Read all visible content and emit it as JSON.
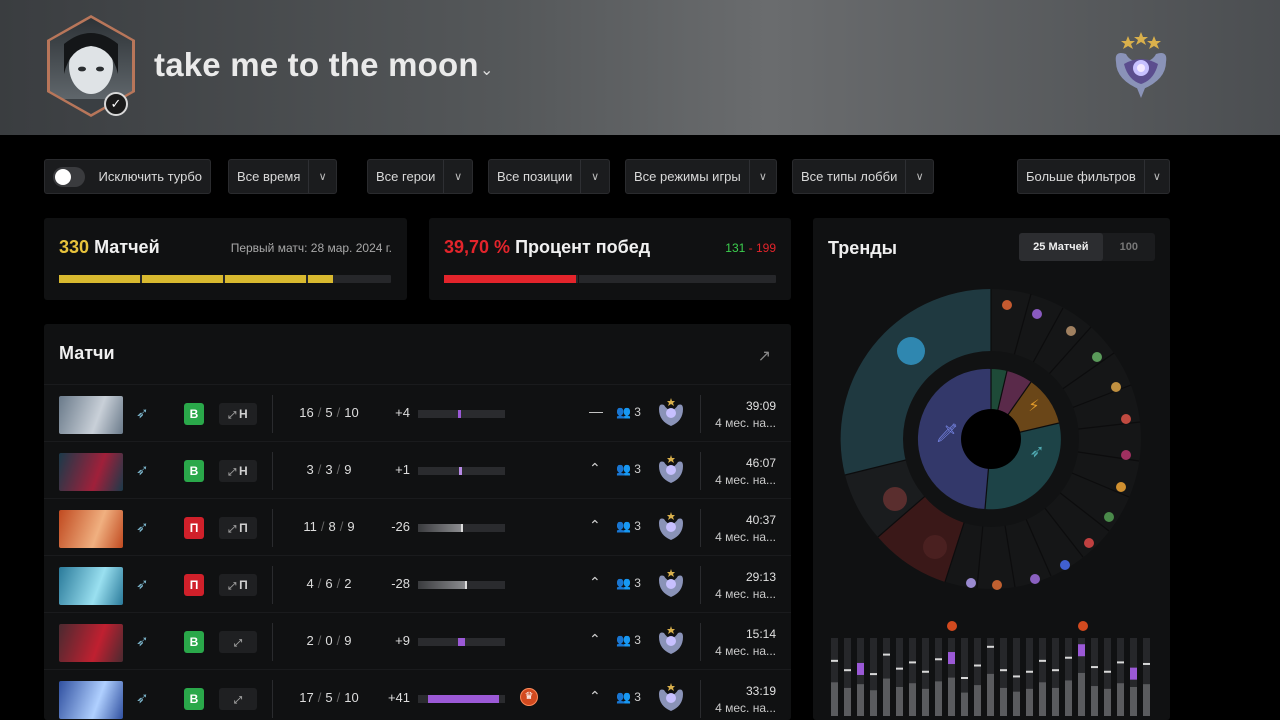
{
  "profile": {
    "name": "take me to the moon",
    "verified_mark": "✓",
    "chevron": "⌄"
  },
  "filters": [
    {
      "label": "Исключить турбо",
      "type": "toggle"
    },
    {
      "label": "Все время"
    },
    {
      "label": "Все герои"
    },
    {
      "label": "Все позиции"
    },
    {
      "label": "Все режимы игры"
    },
    {
      "label": "Все типы лобби"
    },
    {
      "label": "Больше фильтров"
    }
  ],
  "stats": {
    "matches": {
      "count": "330",
      "label": "Матчей",
      "first_match": "Первый матч: 28 мар. 2024 г."
    },
    "winrate": {
      "value": "39,70 %",
      "label": "Процент побед",
      "wins": "131",
      "dash": " - ",
      "losses": "199",
      "fraction": 0.397
    }
  },
  "matches_panel": {
    "title": "Матчи",
    "rows": [
      {
        "result": "В",
        "win": true,
        "lane": "Н",
        "k": "16",
        "d": "5",
        "a": "10",
        "impact": "+4",
        "impact_frac": 0.08,
        "party": "3",
        "duration": "39:09",
        "ago": "4 мес. на...",
        "trend": "—",
        "award": false
      },
      {
        "result": "В",
        "win": true,
        "lane": "Н",
        "k": "3",
        "d": "3",
        "a": "9",
        "impact": "+1",
        "impact_frac": 0.02,
        "party": "3",
        "duration": "46:07",
        "ago": "4 мес. на...",
        "trend": "⌃",
        "award": false
      },
      {
        "result": "П",
        "win": false,
        "lane": "П",
        "k": "11",
        "d": "8",
        "a": "9",
        "impact": "-26",
        "impact_frac": -0.52,
        "party": "3",
        "duration": "40:37",
        "ago": "4 мес. на...",
        "trend": "⌃",
        "award": false
      },
      {
        "result": "П",
        "win": false,
        "lane": "П",
        "k": "4",
        "d": "6",
        "a": "2",
        "impact": "-28",
        "impact_frac": -0.56,
        "party": "3",
        "duration": "29:13",
        "ago": "4 мес. на...",
        "trend": "⌃",
        "award": false
      },
      {
        "result": "В",
        "win": true,
        "lane": "",
        "k": "2",
        "d": "0",
        "a": "9",
        "impact": "+9",
        "impact_frac": 0.18,
        "party": "3",
        "duration": "15:14",
        "ago": "4 мес. на...",
        "trend": "⌃",
        "award": false
      },
      {
        "result": "В",
        "win": true,
        "lane": "",
        "k": "17",
        "d": "5",
        "a": "10",
        "impact": "+41",
        "impact_frac": 0.82,
        "party": "3",
        "duration": "33:19",
        "ago": "4 мес. на...",
        "trend": "⌃",
        "award": true
      }
    ]
  },
  "trends": {
    "title": "Тренды",
    "tabs": [
      "25 Матчей",
      "100"
    ],
    "bars": [
      0.72,
      0.6,
      0.68,
      0.55,
      0.8,
      0.62,
      0.7,
      0.58,
      0.74,
      0.82,
      0.5,
      0.66,
      0.9,
      0.6,
      0.52,
      0.58,
      0.72,
      0.6,
      0.76,
      0.92,
      0.64,
      0.58,
      0.7,
      0.62,
      0.68
    ],
    "purple_marks": [
      2,
      9,
      19,
      23
    ]
  },
  "colors": {
    "accent_yellow": "#e8c33c",
    "win": "#2aa84a",
    "loss": "#d0202a",
    "purple": "#9b59d6"
  }
}
